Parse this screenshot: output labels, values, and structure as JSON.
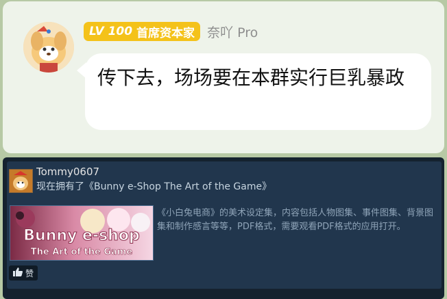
{
  "chat": {
    "badge_level": "LV 100",
    "badge_title": "首席资本家",
    "sender_name": "奈吖 Pro",
    "message": "传下去，场场要在本群实行巨乳暴政"
  },
  "steam_card": {
    "username": "Tommy0607",
    "action_text": "现在拥有了《Bunny e-Shop The Art of the Game》",
    "banner_title": "Bunny e-shop",
    "banner_subtitle": "The Art of the Game",
    "description": "《小白兔电商》的美术设定集，内容包括人物图集、事件图集、背景图集和制作感言等等，PDF格式，需要观看PDF格式的应用打开。",
    "like_label": "赞",
    "like_icon": "thumbs-up-icon"
  },
  "colors": {
    "badge": "#f4c21a",
    "chat_panel": "#eef3ea",
    "steam_bg": "#21364d",
    "steam_text": "#c7d5e0"
  }
}
